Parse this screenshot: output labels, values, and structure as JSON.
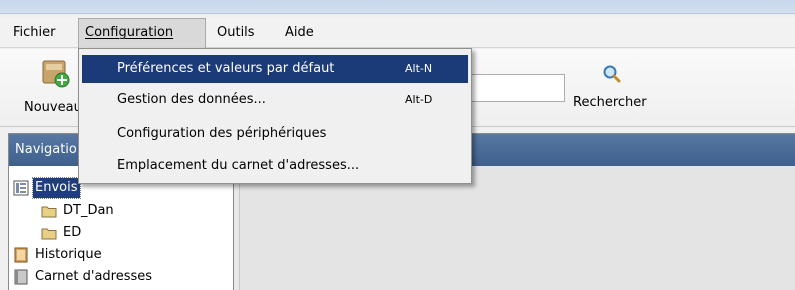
{
  "menubar": {
    "items": [
      {
        "label": "Fichier"
      },
      {
        "label": "Configuration"
      },
      {
        "label": "Outils"
      },
      {
        "label": "Aide"
      }
    ]
  },
  "config_menu": {
    "items": [
      {
        "label": "Préférences et valeurs par défaut",
        "shortcut": "Alt-N"
      },
      {
        "label": "Gestion des données...",
        "shortcut": "Alt-D"
      },
      {
        "label": "Configuration des périphériques"
      },
      {
        "label": "Emplacement du carnet d'adresses..."
      }
    ]
  },
  "toolbar": {
    "new_label": "Nouveau",
    "search_label": "Rechercher",
    "search_value": ""
  },
  "navigation": {
    "title": "Navigation",
    "tree": [
      {
        "label": "Envois"
      },
      {
        "label": "DT_Dan"
      },
      {
        "label": "ED"
      },
      {
        "label": "Historique"
      },
      {
        "label": "Carnet d'adresses"
      }
    ]
  },
  "colors": {
    "menu_highlight": "#1b3a78",
    "panel_header": "#4a6a96",
    "selection": "#1f3d7a"
  }
}
